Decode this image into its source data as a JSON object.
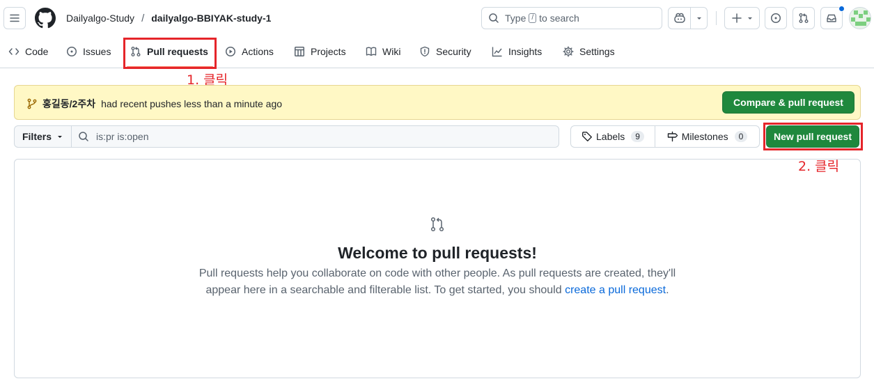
{
  "header": {
    "owner": "Dailyalgo-Study",
    "separator": "/",
    "repo": "dailyalgo-BBIYAK-study-1",
    "search": {
      "prefix": "Type",
      "key": "/",
      "suffix": "to search"
    },
    "icons": [
      "menu-icon",
      "github-logo-icon",
      "search-icon",
      "copilot-icon",
      "chevron-down-icon",
      "plus-icon",
      "issue-icon",
      "pull-request-icon",
      "inbox-icon",
      "avatar"
    ]
  },
  "nav": {
    "items": [
      {
        "label": "Code",
        "icon": "code-icon"
      },
      {
        "label": "Issues",
        "icon": "issue-icon"
      },
      {
        "label": "Pull requests",
        "icon": "pull-request-icon",
        "active": true
      },
      {
        "label": "Actions",
        "icon": "play-icon"
      },
      {
        "label": "Projects",
        "icon": "table-icon"
      },
      {
        "label": "Wiki",
        "icon": "book-icon"
      },
      {
        "label": "Security",
        "icon": "shield-icon"
      },
      {
        "label": "Insights",
        "icon": "graph-icon"
      },
      {
        "label": "Settings",
        "icon": "gear-icon"
      }
    ]
  },
  "annotations": {
    "step1": "1. 클릭",
    "step2": "2. 클릭",
    "color": "#e5252a"
  },
  "banner": {
    "branch": "홍길동/2주차",
    "message": "had recent pushes less than a minute ago",
    "button": "Compare & pull request"
  },
  "filters": {
    "button": "Filters",
    "query": "is:pr is:open",
    "labels": {
      "label": "Labels",
      "count": "9"
    },
    "milestones": {
      "label": "Milestones",
      "count": "0"
    },
    "new_pr": "New pull request"
  },
  "blankslate": {
    "title": "Welcome to pull requests!",
    "desc_1": "Pull requests help you collaborate on code with other people. As pull requests are created, they'll appear here in a searchable and filterable list. To get started, you should ",
    "link": "create a pull request",
    "desc_2": "."
  },
  "colors": {
    "accent_green": "#1f883d",
    "banner_bg": "#fff8c5",
    "link": "#0969da",
    "active_underline": "#fd8c73"
  }
}
